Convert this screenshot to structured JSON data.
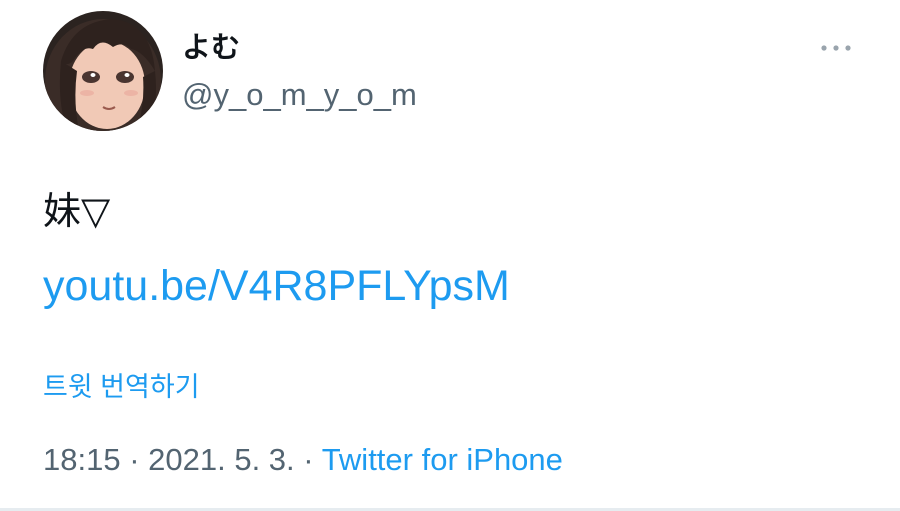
{
  "user": {
    "display_name": "よむ",
    "handle": "@y_o_m_y_o_m",
    "avatar_icon": "avatar-illustration"
  },
  "menu": {
    "icon": "more-options-icon"
  },
  "tweet": {
    "text": "妹▽",
    "link": "youtu.be/V4R8PFLYpsM",
    "translate_label": "트윗 번역하기"
  },
  "meta": {
    "time": "18:15",
    "separator": "·",
    "date": "2021. 5. 3.",
    "source": "Twitter for iPhone"
  },
  "colors": {
    "link": "#1d9bf0",
    "secondary_text": "#536471",
    "primary_text": "#0f1419"
  }
}
